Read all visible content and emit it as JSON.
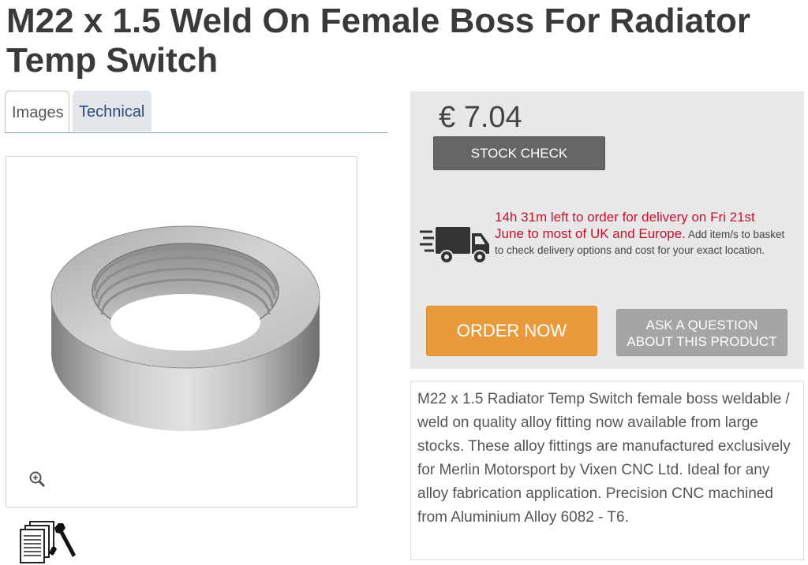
{
  "product": {
    "title": "M22 x 1.5 Weld On Female Boss For Radiator Temp Switch"
  },
  "tabs": [
    {
      "label": "Images",
      "active": true
    },
    {
      "label": "Technical",
      "active": false
    }
  ],
  "gallery": {
    "zoom_icon": "zoom-in-icon",
    "technical_icon": "technical-docs-icon"
  },
  "buy": {
    "price": "€ 7.04",
    "stock_check_label": "STOCK CHECK",
    "delivery_highlight": "14h 31m left to order for delivery on Fri 21st June to most of UK and Europe.",
    "delivery_note": "Add item/s to basket to check delivery options and cost for your exact location.",
    "order_label": "ORDER NOW",
    "ask_label_line1": "ASK A QUESTION",
    "ask_label_line2": "ABOUT THIS PRODUCT"
  },
  "description": "M22 x 1.5 Radiator Temp Switch female boss weldable / weld on quality alloy fitting now available from large stocks. These alloy fittings are manufactured exclusively for Merlin Motorsport by Vixen CNC Ltd. Ideal for any alloy fabrication application. Precision CNC machined from Aluminium Alloy 6082 - T6.",
  "colors": {
    "order_button": "#e99a3c",
    "delivery_highlight": "#c8102e",
    "stock_button": "#666666"
  }
}
